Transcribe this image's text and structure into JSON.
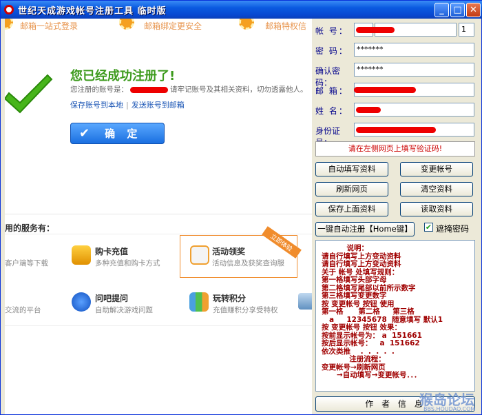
{
  "window": {
    "title": "世纪天成游戏帐号注册工具 临时版",
    "min": "_",
    "max": "□",
    "close": "✕"
  },
  "banner": [
    "邮箱一站式登录",
    "邮箱绑定更安全",
    "邮箱特权信"
  ],
  "success": {
    "heading": "您已经成功注册了!",
    "account_prefix": "您注册的账号是：",
    "account_suffix": "请牢记账号及其相关资料，切勿透露他人。",
    "save_link": "保存账号到本地",
    "send_link": "发送账号到邮箱",
    "confirm": "确 定"
  },
  "services": {
    "title": "用的服务有：",
    "items": [
      {
        "title": "",
        "desc": "客户端等下载"
      },
      {
        "title": "购卡充值",
        "desc": "多种充值和购卡方式"
      },
      {
        "title": "活动领奖",
        "desc": "活动信息及获奖查询服",
        "ribbon": "立即体验"
      },
      {
        "title": "",
        "desc": "交流的平台"
      },
      {
        "title": "问吧提问",
        "desc": "自助解决游戏问题"
      },
      {
        "title": "玩转积分",
        "desc": "充值赚积分享受特权"
      }
    ]
  },
  "form": {
    "labels": [
      "帐    号：",
      "密    码：",
      "确认密码：",
      "邮    箱：",
      "姓    名：",
      "身份证号："
    ],
    "password": "*******",
    "confirm_password": "*******",
    "count": "1",
    "notice": "请在左侧网页上填写验证码!"
  },
  "buttons": {
    "auto_fill": "自动填写资料",
    "change_account": "变更帐号",
    "refresh": "刷新网页",
    "clear": "清空资料",
    "save": "保存上面资料",
    "read": "读取资料",
    "one_click": "一键自动注册【Home键】",
    "mask_pwd": "遮掩密码",
    "author": "作 者 信 息"
  },
  "instructions": [
    "          说明：",
    "请自行填写上方变动资料",
    "请自行填写上方变动资料",
    "",
    "关于 帐号 处填写规则：",
    "第一格填写头部字母",
    "第二格填写尾部以前所示数字",
    "第三格填写变更数字",
    "按 变更帐号 按钮 使用",
    "第一格      第二格     第三格",
    "   a     12345678  随意填写 默认1",
    "按 变更帐号 按钮 效果：",
    "按前显示帐号为： a  151661",
    "按后显示帐号：   a  151662",
    "依次类推    .  .  .  .  .",
    "",
    "           注册流程：",
    "变更帐号→刷新网页",
    "      →自动填写→变更帐号．．．"
  ],
  "watermark": {
    "main": "猴岛论坛",
    "sub": "BBS.HOUDAO.COM"
  }
}
